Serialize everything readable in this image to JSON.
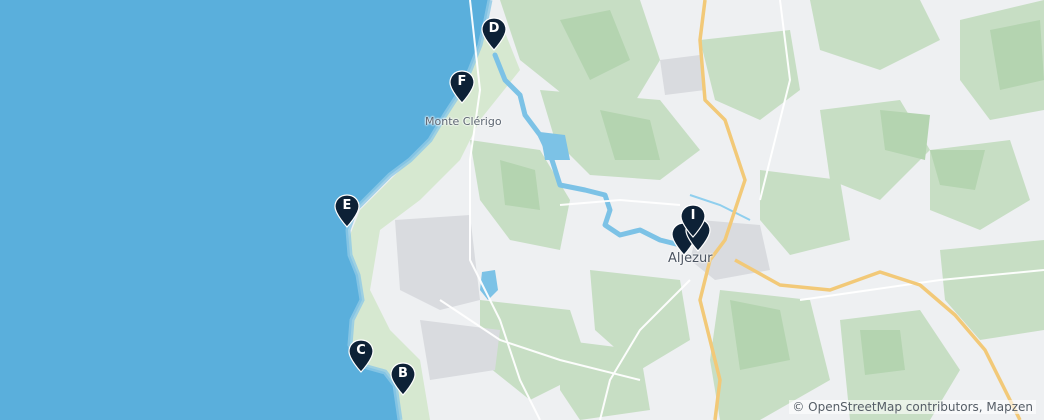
{
  "map": {
    "colors": {
      "ocean": "#5aafdc",
      "land": "#eef0f2",
      "forest": "#c5ddc2",
      "forest_dark": "#b3d3af",
      "urban": "#dcdde1",
      "road_major": "#f2c978",
      "river": "#7cc2e6",
      "pin": "#0d2136"
    },
    "place_labels": {
      "village": "Monte Clérigo",
      "town": "Aljezur"
    },
    "markers": [
      {
        "letter": "D"
      },
      {
        "letter": "F"
      },
      {
        "letter": "E"
      },
      {
        "letter": "C"
      },
      {
        "letter": "B"
      },
      {
        "letter": "I"
      },
      {
        "letter": ""
      },
      {
        "letter": ""
      }
    ],
    "attribution": "© OpenStreetMap contributors, Mapzen"
  }
}
